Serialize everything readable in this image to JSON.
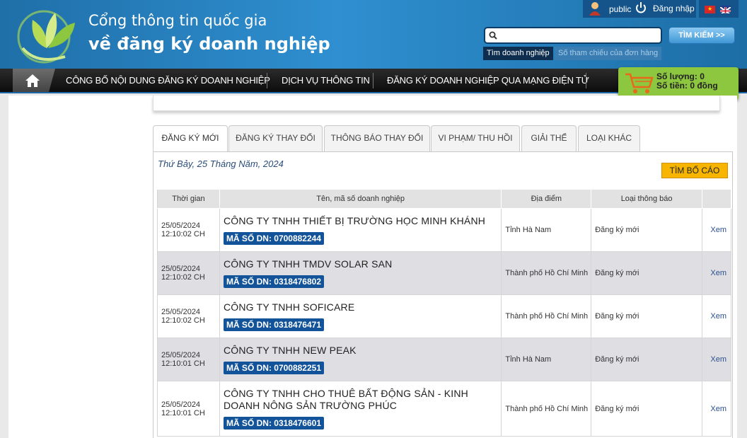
{
  "header": {
    "title_line1": "Cổng thông tin quốc gia",
    "title_line2": "về đăng ký doanh nghiệp",
    "user": "public",
    "login_label": "Đăng nhập",
    "search_placeholder": "",
    "search_button": "TÌM KIẾM >>",
    "search_tabs": [
      "Tìm doanh nghiệp",
      "Số tham chiếu của đơn hàng"
    ]
  },
  "nav": {
    "items": [
      "CÔNG BỐ NỘI DUNG ĐĂNG KÝ DOANH NGHIỆP",
      "DỊCH VỤ THÔNG TIN",
      "ĐĂNG KÝ DOANH NGHIỆP QUA MẠNG ĐIỆN TỬ"
    ]
  },
  "cart": {
    "quantity": "Số lượng: 0",
    "amount": "Số tiền: 0 đồng"
  },
  "tabs": [
    "ĐĂNG KÝ MỚI",
    "ĐĂNG KÝ THAY ĐỔI",
    "THÔNG BÁO THAY ĐỔI",
    "VI PHẠM/ THU HỒI",
    "GIẢI THỂ",
    "LOẠI KHÁC"
  ],
  "date": "Thứ Bảy, 25 Tháng Năm, 2024",
  "report_button": "TÌM BỐ CÁO",
  "table": {
    "headers": [
      "Thời gian",
      "Tên, mã số doanh nghiệp",
      "Địa điểm",
      "Loại thông báo",
      ""
    ],
    "rows": [
      {
        "date": "25/05/2024",
        "time": "12:10:02 CH",
        "name": "CÔNG TY TNHH THIẾT BỊ TRƯỜNG HỌC MINH KHÁNH",
        "code": "MÃ SỐ DN: 0700882244",
        "place": "Tỉnh Hà Nam",
        "type": "Đăng ký mới",
        "action": "Xem"
      },
      {
        "date": "25/05/2024",
        "time": "12:10:02 CH",
        "name": "CÔNG TY TNHH TMDV SOLAR SAN",
        "code": "MÃ SỐ DN: 0318476802",
        "place": "Thành phố Hồ Chí Minh",
        "type": "Đăng ký mới",
        "action": "Xem"
      },
      {
        "date": "25/05/2024",
        "time": "12:10:02 CH",
        "name": "CÔNG TY TNHH SOFICARE",
        "code": "MÃ SỐ DN: 0318476471",
        "place": "Thành phố Hồ Chí Minh",
        "type": "Đăng ký mới",
        "action": "Xem"
      },
      {
        "date": "25/05/2024",
        "time": "12:10:01 CH",
        "name": "CÔNG TY TNHH NEW PEAK",
        "code": "MÃ SỐ DN: 0700882251",
        "place": "Tỉnh Hà Nam",
        "type": "Đăng ký mới",
        "action": "Xem"
      },
      {
        "date": "25/05/2024",
        "time": "12:10:01 CH",
        "name": "CÔNG TY TNHH CHO THUÊ BẤT ĐỘNG SẢN - KINH DOANH NÔNG SẢN TRƯỜNG PHÚC",
        "code": "MÃ SỐ DN: 0318476601",
        "place": "Thành phố Hồ Chí Minh",
        "type": "Đăng ký mới",
        "action": "Xem"
      }
    ]
  },
  "colors": {
    "brand_blue": "#2f8fd0",
    "badge": "#12539a",
    "cart": "#8dc63f",
    "report": "#f7b500"
  }
}
